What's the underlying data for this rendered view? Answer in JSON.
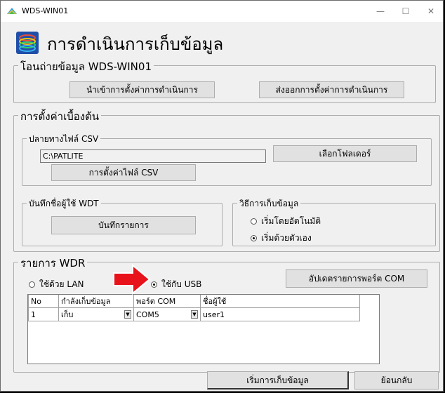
{
  "window": {
    "title": "WDS-WIN01"
  },
  "titlebar": {
    "minimize": "—",
    "maximize": "☐",
    "close": "✕"
  },
  "header": {
    "title": "การดำเนินการเก็บข้อมูล"
  },
  "transfer_group": {
    "legend": "โอนถ่ายข้อมูล WDS-WIN01",
    "import_button": "นำเข้าการตั้งค่าการดำเนินการ",
    "export_button": "ส่งออกการตั้งค่าการดำเนินการ"
  },
  "settings_group": {
    "legend": "การตั้งค่าเบื้องต้น",
    "csv": {
      "legend": "ปลายทางไฟล์ CSV",
      "path_value": "C:\\PATLITE",
      "browse_button": "เลือกโฟลเดอร์",
      "csv_settings_button": "การตั้งค่าไฟล์ CSV"
    },
    "wdt": {
      "legend": "บันทึกชื่อผู้ใช้ WDT",
      "register_button": "บันทึกรายการ"
    },
    "method": {
      "legend": "วิธีการเก็บข้อมูล",
      "auto_label": "เริ่มโดยอัตโนมัติ",
      "manual_label": "เริ่มด้วยตัวเอง",
      "selected": "manual"
    }
  },
  "wdr_group": {
    "legend": "รายการ WDR",
    "lan_label": "ใช้ด้วย LAN",
    "usb_label": "ใช้กับ USB",
    "selected": "usb",
    "update_com_button": "อัปเดตรายการพอร์ต COM",
    "columns": [
      "No",
      "กำลังเก็บข้อมูล",
      "พอร์ต COM",
      "ชื่อผู้ใช้"
    ],
    "rows": [
      {
        "no": "1",
        "status": "เก็บ",
        "port": "COM5",
        "user": "user1"
      }
    ]
  },
  "footer": {
    "start_button": "เริ่มการเก็บข้อมูล",
    "back_button": "ย้อนกลับ"
  },
  "colors": {
    "arrow": "#e8121b",
    "arrow_outline": "#ffffff"
  }
}
